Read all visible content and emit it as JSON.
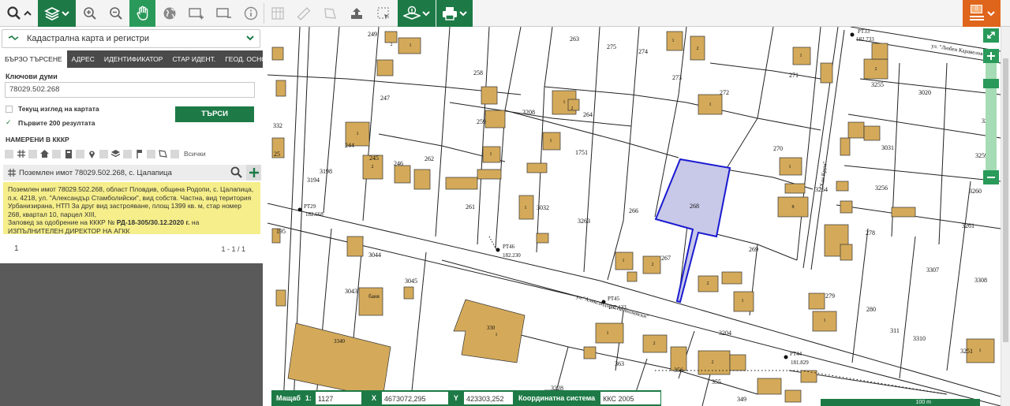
{
  "toolbar": {
    "buttons": [
      "search",
      "layers",
      "zoom-in",
      "zoom-out",
      "pan",
      "globe",
      "add-layer",
      "remove-layer",
      "info",
      "measure-grid",
      "ruler",
      "polygon",
      "upload",
      "select-area",
      "identify",
      "print"
    ],
    "notification_count": "0"
  },
  "sidebar": {
    "layer_select": "Кадастрална карта и регистри",
    "tabs": [
      "БЪРЗО ТЪРСЕНЕ",
      "АДРЕС",
      "ИДЕНТИФИКАТОР",
      "СТАР ИДЕНТ.",
      "ГЕОД. ОСНОВА"
    ],
    "keywords_label": "Ключови думи",
    "search_value": "78029.502.268",
    "current_view_label": "Текущ изглед на картата",
    "first200_label": "Първите 200 резултата",
    "first200_check": "✓",
    "search_button": "ТЪРСИ",
    "found_title": "НАМЕРЕНИ В КККР",
    "filter_all": "Всички",
    "result_title": "Поземлен имот 78029.502.268, с. Цалапица",
    "result_text": "Поземлен имот 78029.502.268, област Пловдив, община Родопи, с. Цалапица, п.к. 4218, ул. \"Александър Стамболийски\", вид собств. Частна, вид територия Урбанизирана, НТП За друг вид застрояване, площ 1399 кв. м, стар номер 268, квартал 10, парцел XIII,",
    "result_order_prefix": "Заповед за одобрение на КККР № ",
    "result_order_bold": "РД-18-305/30.12.2020 г.",
    "result_order_suffix": " на ИЗПЪЛНИТЕЛЕН ДИРЕКТОР НА АГКК",
    "page": "1",
    "page_range": "1 - 1 / 1"
  },
  "map": {
    "parcel_labels": [
      "249",
      "263",
      "275",
      "274",
      "273",
      "272",
      "271",
      "3255",
      "3020",
      "258",
      "247",
      "259",
      "3208",
      "264",
      "1751",
      "270",
      "3031",
      "3258",
      "262",
      "246",
      "245",
      "261",
      "3032",
      "3263",
      "266",
      "268",
      "3264",
      "3256",
      "3260",
      "3259",
      "244",
      "3194",
      "3198",
      "267",
      "269",
      "278",
      "3261",
      "3044",
      "3045",
      "3043",
      "279",
      "280",
      "3307",
      "3308",
      "3204",
      "3310",
      "363",
      "356",
      "355",
      "349",
      "3228",
      "311",
      "3251"
    ],
    "building_labels": [
      "1",
      "2",
      "3",
      "4",
      "5",
      "8",
      "баня"
    ],
    "points": [
      {
        "name": "PT33",
        "elev": "182.733"
      },
      {
        "name": "PT29",
        "elev": "182.668"
      },
      {
        "name": "PT46",
        "elev": "182.230"
      },
      {
        "name": "PT45",
        "elev": "182.133"
      },
      {
        "name": "PT44",
        "elev": "181.829"
      }
    ],
    "street_1": "ул.\"Александър Стамболийски\"",
    "street_2": "ул. \"Любен Каравелов\"",
    "street_3": "\"Хан Крум\"",
    "scale_text": "100 m"
  },
  "status": {
    "scale_label": "Мащаб",
    "scale_prefix": "1:",
    "scale_value": "1127",
    "x_label": "X",
    "x_value": "4673072,295",
    "y_label": "Y",
    "y_value": "423303,252",
    "crs_label": "Координатна система",
    "crs_value": "ККС 2005"
  },
  "colors": {
    "accent": "#1d7a46",
    "orange": "#e0651c",
    "building": "#d4aa5a",
    "highlight": "#c8c8e8",
    "highlight_border": "#1a1ad0",
    "result_bg": "#f5ee8a"
  }
}
